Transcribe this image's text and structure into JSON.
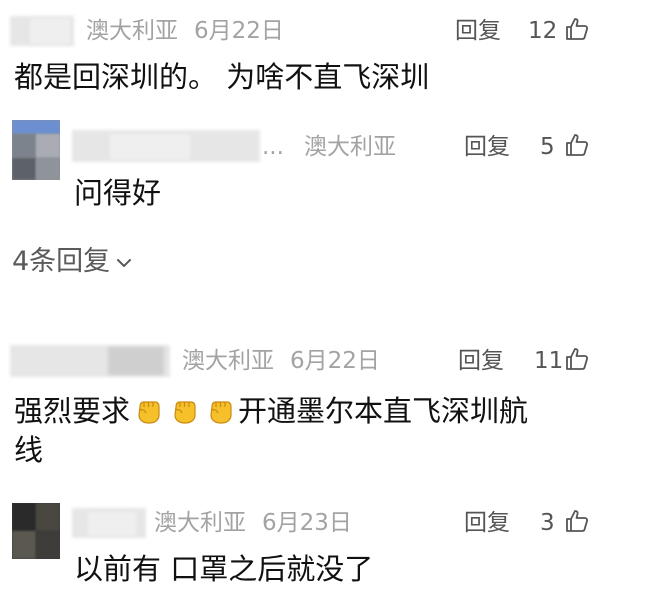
{
  "comments": [
    {
      "location": "澳大利亚",
      "date": "6月22日",
      "reply_label": "回复",
      "likes": "12",
      "text": "都是回深圳的。 为啥不直飞深圳"
    },
    {
      "ellipsis": "...",
      "location": "澳大利亚",
      "reply_label": "回复",
      "likes": "5",
      "text": "问得好"
    },
    {
      "location": "澳大利亚",
      "date": "6月22日",
      "reply_label": "回复",
      "likes": "11",
      "text_before": "强烈要求",
      "text_after": "开通墨尔本直飞深圳航",
      "text_line2": "线"
    },
    {
      "location": "澳大利亚",
      "date": "6月23日",
      "reply_label": "回复",
      "likes": "3",
      "text": "以前有 口罩之后就没了"
    }
  ],
  "more_replies": {
    "label": "4条回复"
  },
  "icons": {
    "like": "thumbs-up-icon",
    "fist": "raised-fist-emoji",
    "chevron": "chevron-down-icon"
  },
  "colors": {
    "meta": "#a3a3a3",
    "action": "#555555",
    "text": "#111111",
    "fist": "#f5c02a"
  }
}
